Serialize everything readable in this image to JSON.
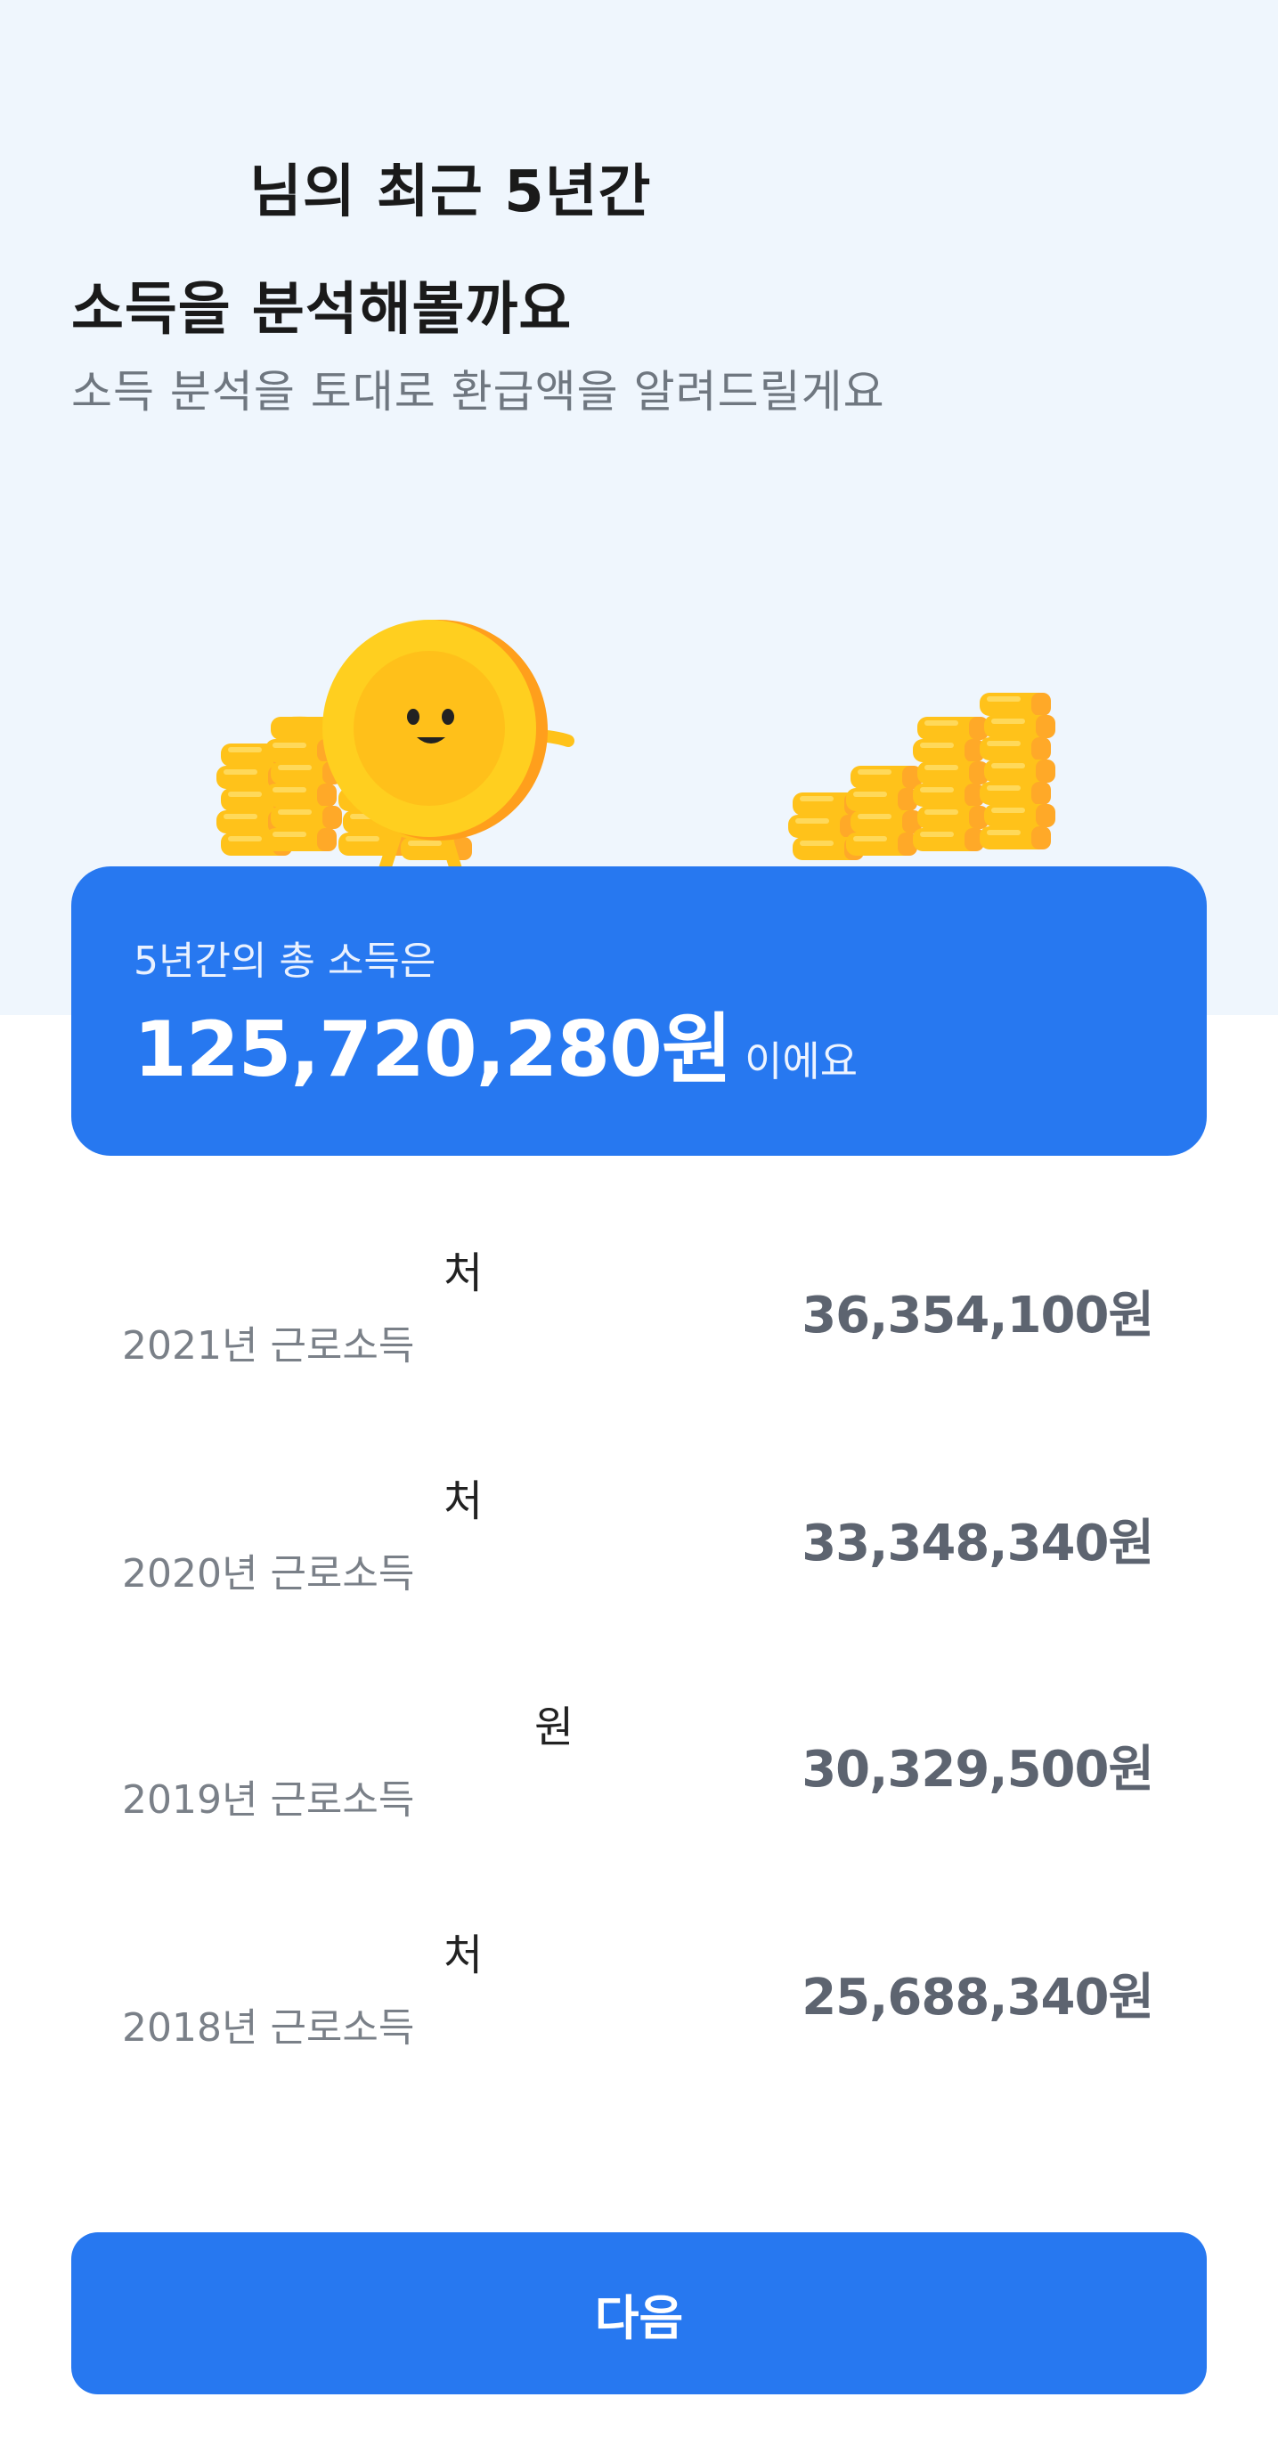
{
  "header": {
    "title_line1": "님의 최근 5년간",
    "title_line2": "소득을 분석해볼까요",
    "subtitle": "소득 분석을 토대로 환급액을 알려드릴게요"
  },
  "summary": {
    "label": "5년간의 총 소득은",
    "total_amount": "125,720,280원",
    "suffix": "이에요"
  },
  "income_rows": [
    {
      "employer": "처",
      "year_label": "2021년 근로소득",
      "amount": "36,354,100원"
    },
    {
      "employer": "처",
      "year_label": "2020년 근로소득",
      "amount": "33,348,340원"
    },
    {
      "employer": "원",
      "year_label": "2019년 근로소득",
      "amount": "30,329,500원"
    },
    {
      "employer": "처",
      "year_label": "2018년 근로소득",
      "amount": "25,688,340원"
    }
  ],
  "footer": {
    "next_button_label": "다음"
  },
  "icons": {
    "illustration": "coin-character-icon",
    "coin_stacks": "coin-stack-icon"
  },
  "colors": {
    "accent": "#2778f0",
    "hero_background": "#eff6fd",
    "coin": "#ffc61a"
  }
}
